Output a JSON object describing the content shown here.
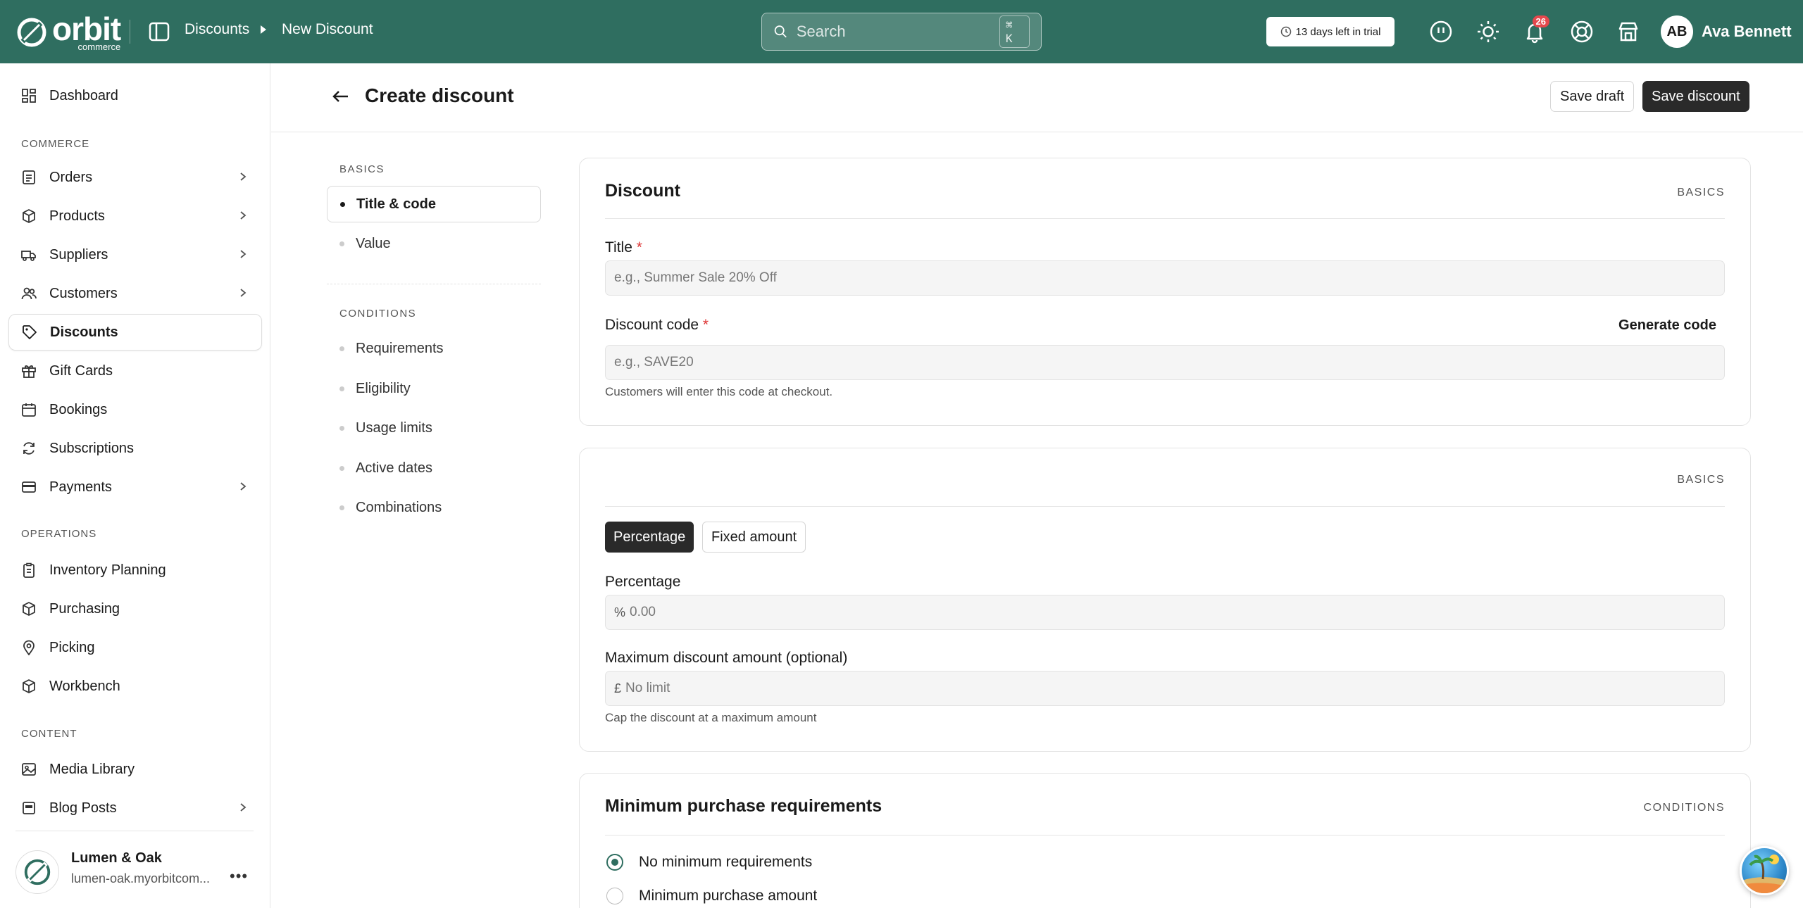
{
  "brand": {
    "logo_word": "orbit",
    "logo_sub": "commerce"
  },
  "breadcrumb": [
    "Discounts",
    "New Discount"
  ],
  "search": {
    "placeholder": "Search",
    "shortcut": "⌘ K"
  },
  "trial": {
    "label": "13 days left in trial"
  },
  "notifications": {
    "count": "26"
  },
  "user": {
    "initials": "AB",
    "name": "Ava Bennett"
  },
  "sidebar": {
    "dashboard": "Dashboard",
    "sections": {
      "commerce": "COMMERCE",
      "operations": "OPERATIONS",
      "content": "CONTENT"
    },
    "commerce_items": [
      {
        "label": "Orders",
        "icon": "orders-icon",
        "has_children": true
      },
      {
        "label": "Products",
        "icon": "box-icon",
        "has_children": true
      },
      {
        "label": "Suppliers",
        "icon": "truck-icon",
        "has_children": true
      },
      {
        "label": "Customers",
        "icon": "users-icon",
        "has_children": true
      },
      {
        "label": "Discounts",
        "icon": "tag-icon",
        "has_children": false,
        "active": true
      },
      {
        "label": "Gift Cards",
        "icon": "gift-icon",
        "has_children": false
      },
      {
        "label": "Bookings",
        "icon": "calendar-icon",
        "has_children": false
      },
      {
        "label": "Subscriptions",
        "icon": "refresh-icon",
        "has_children": false
      },
      {
        "label": "Payments",
        "icon": "card-icon",
        "has_children": true
      }
    ],
    "operations_items": [
      {
        "label": "Inventory Planning",
        "icon": "clipboard-icon"
      },
      {
        "label": "Purchasing",
        "icon": "box-icon"
      },
      {
        "label": "Picking",
        "icon": "pin-icon"
      },
      {
        "label": "Workbench",
        "icon": "box-icon"
      }
    ],
    "content_items": [
      {
        "label": "Media Library",
        "icon": "image-icon"
      },
      {
        "label": "Blog Posts",
        "icon": "doc-icon",
        "has_children": true
      }
    ],
    "store": {
      "name": "Lumen & Oak",
      "url": "lumen-oak.myorbitcom..."
    }
  },
  "page": {
    "title": "Create discount",
    "save_draft": "Save draft",
    "save_discount": "Save discount"
  },
  "section_nav": {
    "basics_label": "BASICS",
    "basics": [
      "Title & code",
      "Value"
    ],
    "conditions_label": "CONDITIONS",
    "conditions": [
      "Requirements",
      "Eligibility",
      "Usage limits",
      "Active dates",
      "Combinations"
    ]
  },
  "discount_card": {
    "title": "Discount",
    "tag": "BASICS",
    "title_label": "Title",
    "title_placeholder": "e.g., Summer Sale 20% Off",
    "code_label": "Discount code",
    "generate_code": "Generate code",
    "code_placeholder": "e.g., SAVE20",
    "code_help": "Customers will enter this code at checkout."
  },
  "value_card": {
    "tag": "BASICS",
    "type_percentage": "Percentage",
    "type_fixed": "Fixed amount",
    "percentage_label": "Percentage",
    "percentage_prefix": "%",
    "percentage_placeholder": "0.00",
    "max_label": "Maximum discount amount (optional)",
    "max_prefix": "£",
    "max_placeholder": "No limit",
    "max_help": "Cap the discount at a maximum amount"
  },
  "min_card": {
    "title": "Minimum purchase requirements",
    "tag": "CONDITIONS",
    "option_none": "No minimum requirements",
    "option_amount": "Minimum purchase amount",
    "selected": "No minimum requirements"
  },
  "colors": {
    "brand": "#2f6e60",
    "primary_button": "#2a2a2a",
    "badge": "#e5484d"
  }
}
